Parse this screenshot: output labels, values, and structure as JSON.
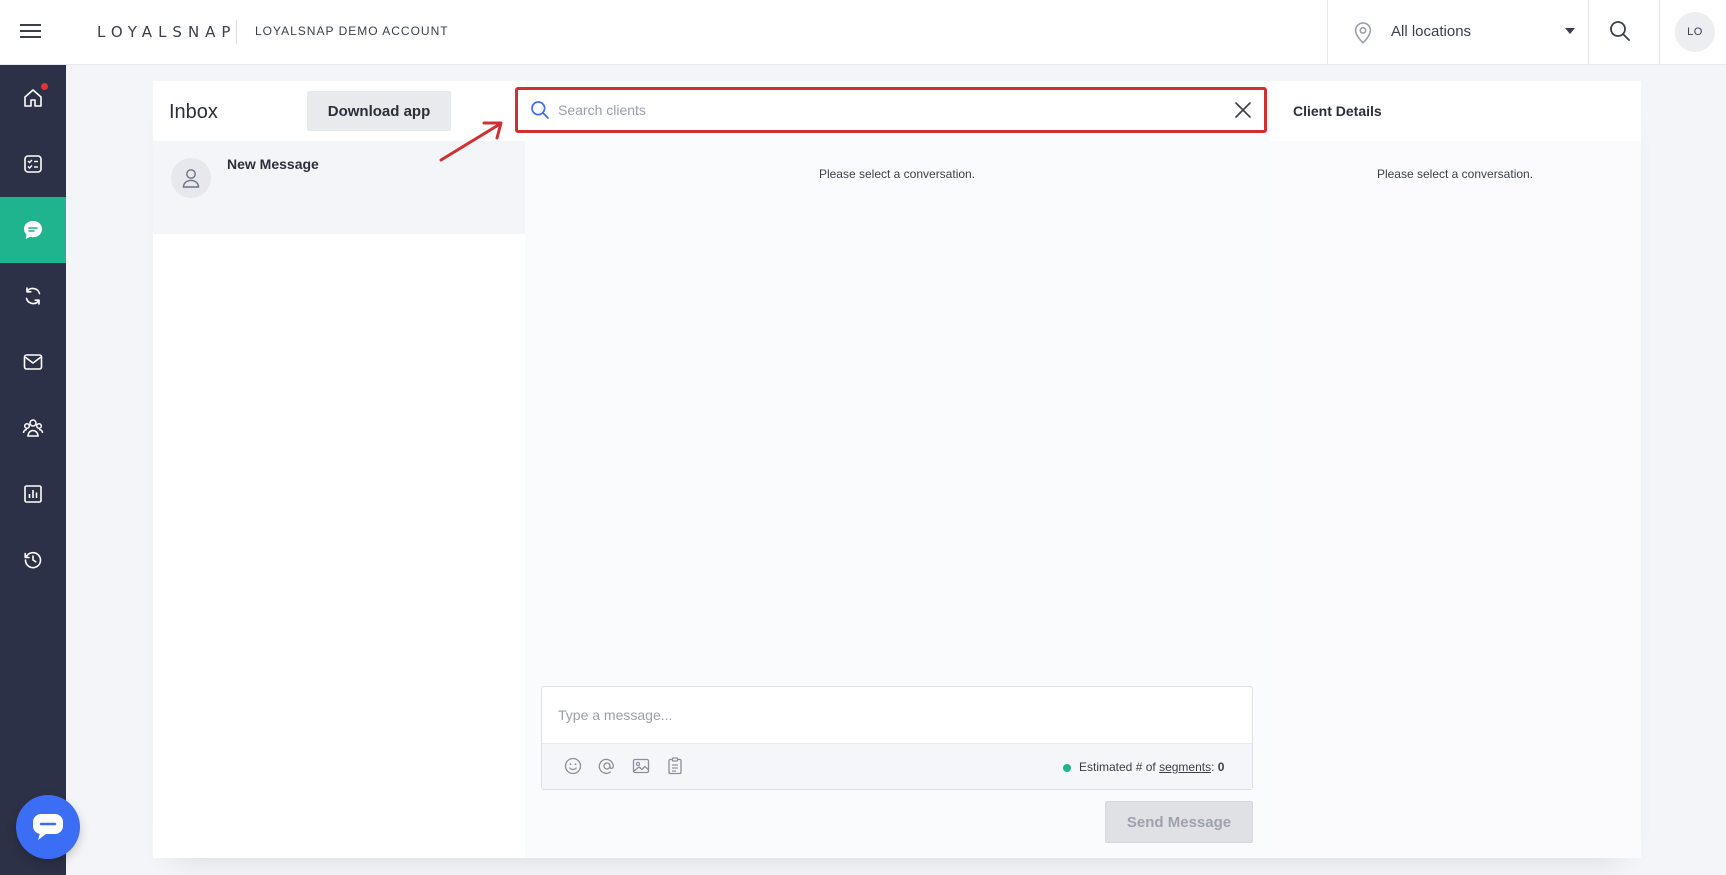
{
  "header": {
    "brand": "LOYALSNAP",
    "account": "LOYALSNAP DEMO ACCOUNT",
    "location_selector": "All locations",
    "avatar_initials": "LO"
  },
  "sidebar": {
    "items": [
      {
        "name": "home",
        "icon": "home-icon"
      },
      {
        "name": "tasks",
        "icon": "checklist-icon",
        "has_notification": true
      },
      {
        "name": "inbox",
        "icon": "chat-icon",
        "active": true
      },
      {
        "name": "automations",
        "icon": "refresh-icon"
      },
      {
        "name": "campaigns",
        "icon": "mail-icon"
      },
      {
        "name": "clients",
        "icon": "people-icon"
      },
      {
        "name": "reports",
        "icon": "chart-icon"
      },
      {
        "name": "history",
        "icon": "history-icon"
      }
    ]
  },
  "inbox": {
    "title": "Inbox",
    "download_button": "Download app",
    "conversations": [
      {
        "name": "New Message"
      }
    ]
  },
  "conversation": {
    "search_placeholder": "Search clients",
    "empty_text": "Please select a conversation.",
    "composer_placeholder": "Type a message...",
    "segments_label": "Estimated # of",
    "segments_link": "segments",
    "segments_count": "0",
    "send_button": "Send Message"
  },
  "details": {
    "title": "Client Details",
    "empty_text": "Please select a conversation."
  },
  "colors": {
    "accent": "#1fb38e",
    "sidebar": "#2c3147",
    "highlight": "#cf3131",
    "chat_launcher": "#3b6ef5"
  }
}
